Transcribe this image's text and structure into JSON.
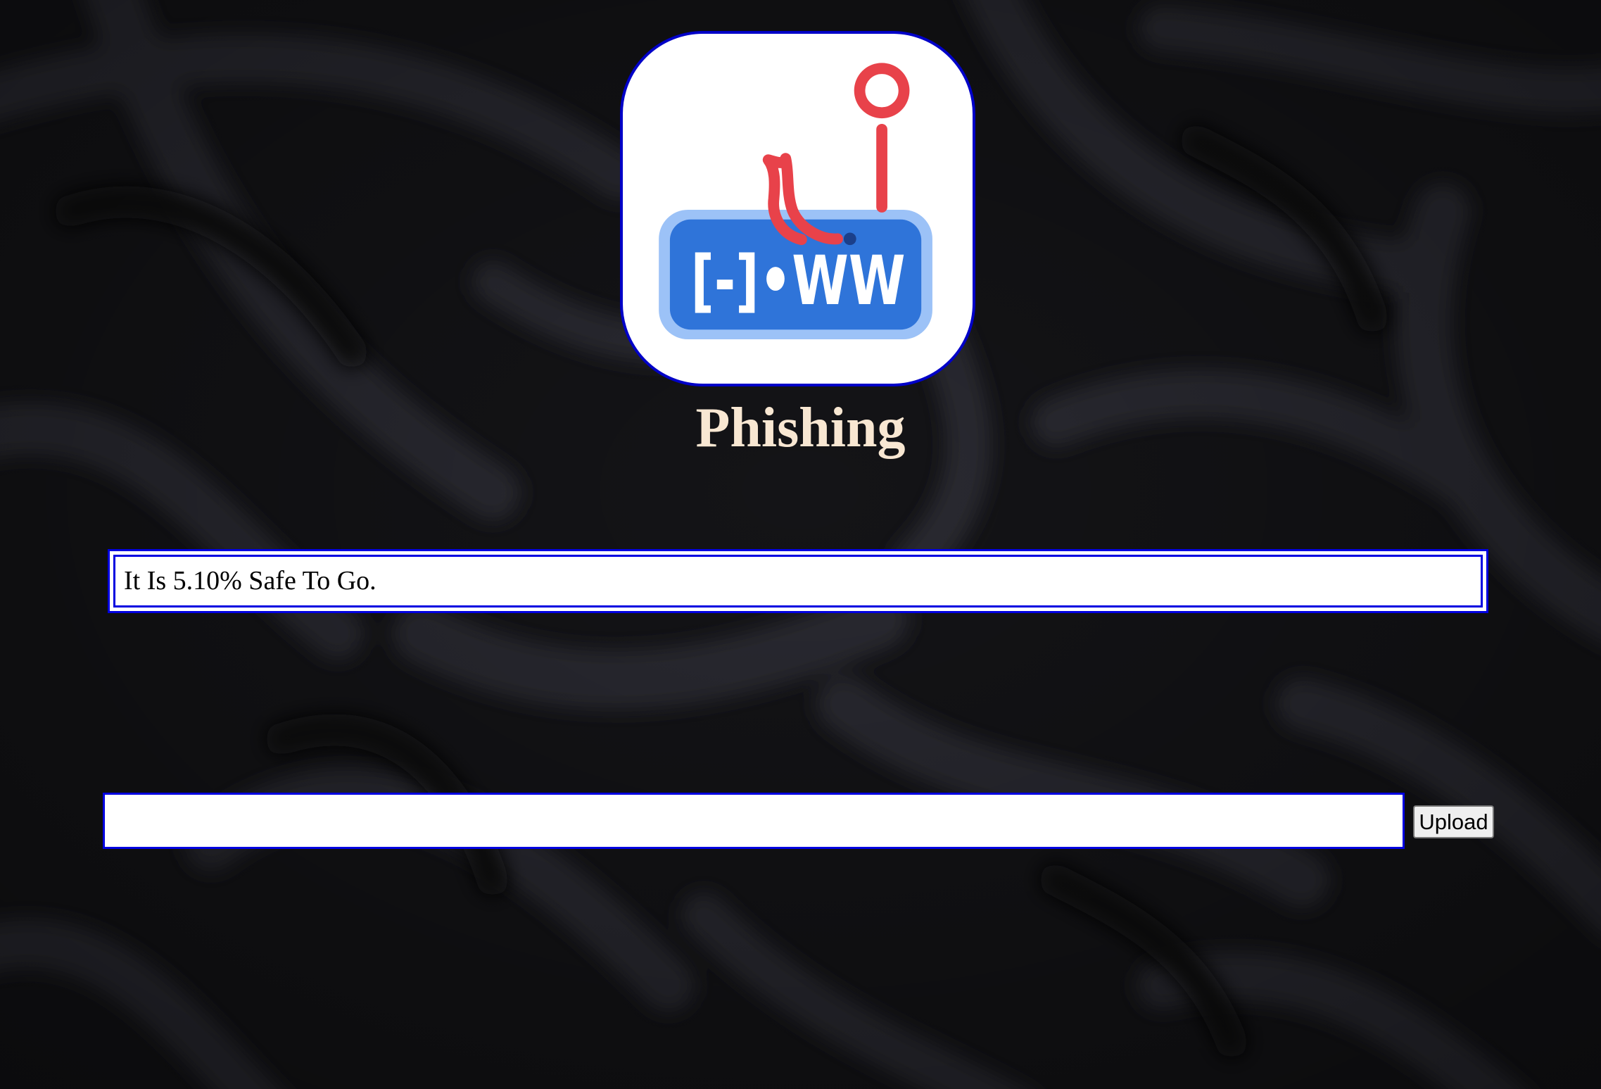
{
  "app": {
    "title": "Phishing",
    "title_color": "#f8e7d2",
    "accent_border_color": "#0000e0"
  },
  "logo": {
    "icon": "phishing-hook-www-icon",
    "label_text": "[-]•WW",
    "hook_color": "#e8424a",
    "tag_color": "#2f74d9",
    "tag_outline_color": "#9cc2f7"
  },
  "result": {
    "text": "It Is 5.10% Safe To Go."
  },
  "upload": {
    "input_value": "",
    "button_label": "Upload"
  }
}
